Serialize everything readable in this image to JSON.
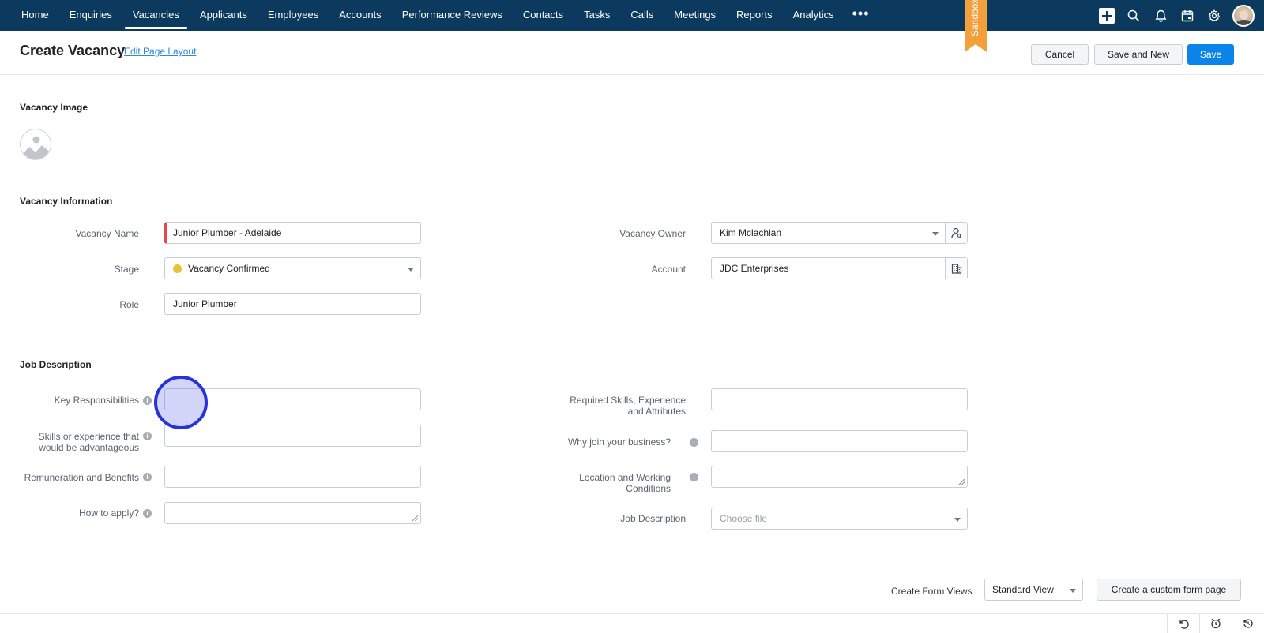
{
  "nav": {
    "items": [
      {
        "label": "Home"
      },
      {
        "label": "Enquiries"
      },
      {
        "label": "Vacancies",
        "active": true
      },
      {
        "label": "Applicants"
      },
      {
        "label": "Employees"
      },
      {
        "label": "Accounts"
      },
      {
        "label": "Performance Reviews"
      },
      {
        "label": "Contacts"
      },
      {
        "label": "Tasks"
      },
      {
        "label": "Calls"
      },
      {
        "label": "Meetings"
      },
      {
        "label": "Reports"
      },
      {
        "label": "Analytics"
      }
    ],
    "more": "•••",
    "sandbox": "Sandbox",
    "icons": [
      "plus-icon",
      "search-icon",
      "bell-icon",
      "calendar-icon",
      "gear-icon",
      "avatar"
    ]
  },
  "header": {
    "title": "Create Vacancy",
    "edit_layout": "Edit Page Layout",
    "cancel": "Cancel",
    "save_new": "Save and New",
    "save": "Save"
  },
  "sections": {
    "image": "Vacancy Image",
    "info": "Vacancy Information",
    "job": "Job Description"
  },
  "info": {
    "vacancy_name_label": "Vacancy Name",
    "vacancy_name": "Junior Plumber - Adelaide",
    "stage_label": "Stage",
    "stage": "Vacancy Confirmed",
    "role_label": "Role",
    "role": "Junior Plumber",
    "owner_label": "Vacancy Owner",
    "owner": "Kim Mclachlan",
    "account_label": "Account",
    "account": "JDC Enterprises"
  },
  "job": {
    "key_resp_label": "Key Responsibilities",
    "skills_adv_label_1": "Skills or experience that",
    "skills_adv_label_2": "would be advantageous",
    "remuneration_label": "Remuneration and Benefits",
    "how_apply_label": "How to apply?",
    "required_label_1": "Required Skills, Experience",
    "required_label_2": "and Attributes",
    "why_join_label": "Why join your business?",
    "location_label_1": "Location and Working",
    "location_label_2": "Conditions",
    "job_desc_label": "Job Description",
    "job_desc_placeholder": "Choose file"
  },
  "footer": {
    "form_views_label": "Create Form Views",
    "view_selected": "Standard View",
    "custom_button": "Create a custom form page"
  },
  "colors": {
    "nav_bg": "#0c3a5f",
    "primary": "#0a84e8",
    "sandbox": "#f3a03c",
    "required": "#e14b4b",
    "stage_dot": "#e8c13d",
    "click_marker": "#2732d8"
  }
}
